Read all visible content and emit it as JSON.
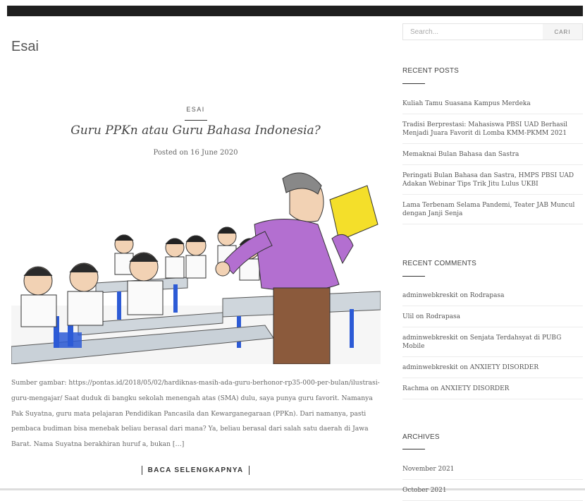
{
  "topbar": {
    "text": "· · · · · · · · · · · ·"
  },
  "page_title": "Esai",
  "post": {
    "category": "ESAI",
    "title": "Guru PPKn atau Guru Bahasa Indonesia?",
    "posted_prefix": "Posted on",
    "date": "16 June 2020",
    "excerpt": "Sumber gambar: https://pontas.id/2018/05/02/hardiknas-masih-ada-guru-berhonor-rp35-000-per-bulan/ilustrasi-guru-mengajar/   Saat duduk di bangku sekolah menengah atas (SMA) dulu, saya punya guru favorit. Namanya Pak Suyatna, guru mata pelajaran Pendidikan Pancasila dan Kewarganegaraan (PPKn). Dari namanya, pasti pembaca budiman bisa menebak beliau berasal dari mana? Ya, beliau berasal dari salah satu daerah di Jawa Barat. Nama Suyatna berakhiran huruf a, bukan […]",
    "read_more": "BACA SELENGKAPNYA"
  },
  "search": {
    "placeholder": "Search...",
    "button": "CARI"
  },
  "recent_posts": {
    "title": "RECENT POSTS",
    "items": [
      "Kuliah Tamu Suasana Kampus Merdeka",
      "Tradisi Berprestasi: Mahasiswa PBSI UAD Berhasil Menjadi Juara Favorit di Lomba KMM-PKMM 2021",
      "Memaknai Bulan Bahasa dan Sastra",
      "Peringati Bulan Bahasa dan Sastra, HMPS PBSI UAD Adakan Webinar Tips Trik Jitu Lulus UKBI",
      "Lama Terbenam Selama Pandemi, Teater JAB Muncul dengan Janji Senja"
    ]
  },
  "recent_comments": {
    "title": "RECENT COMMENTS",
    "items": [
      {
        "author": "adminwebkreskit",
        "on": "on",
        "post": "Rodrapasa"
      },
      {
        "author": "Ulil",
        "on": "on",
        "post": "Rodrapasa"
      },
      {
        "author": "adminwebkreskit",
        "on": "on",
        "post": "Senjata Terdahsyat di PUBG Mobile"
      },
      {
        "author": "adminwebkreskit",
        "on": "on",
        "post": "ANXIETY DISORDER"
      },
      {
        "author": "Rachma",
        "on": "on",
        "post": "ANXIETY DISORDER"
      }
    ]
  },
  "archives": {
    "title": "ARCHIVES",
    "items": [
      "November 2021",
      "October 2021"
    ]
  }
}
